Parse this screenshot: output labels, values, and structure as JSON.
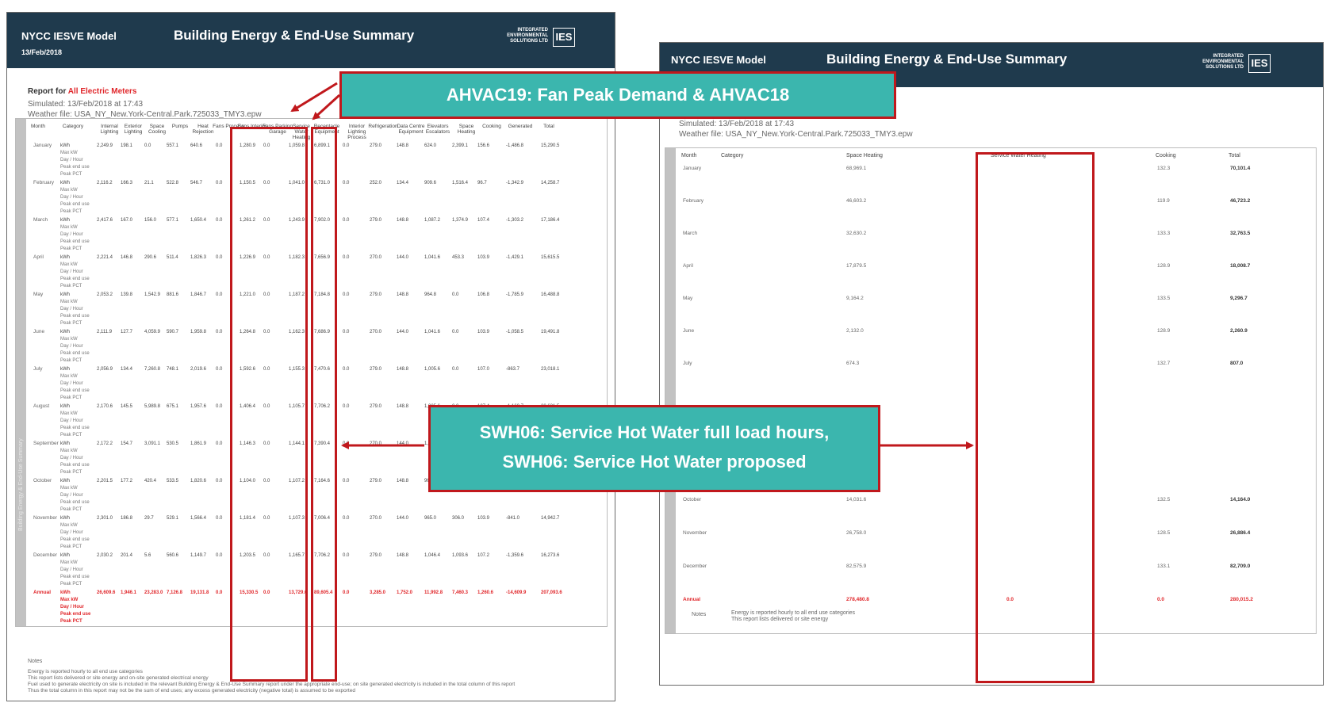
{
  "left": {
    "model_title": "NYCC IESVE Model",
    "building_title": "Building Energy & End-Use Summary",
    "date": "13/Feb/2018",
    "ies_text_1": "INTEGRATED",
    "ies_text_2": "ENVIRONMENTAL",
    "ies_text_3": "SOLUTIONS LTD",
    "ies_logo": "IES",
    "report_prefix": "Report for",
    "report_meters": "All Electric Meters",
    "simulated": "Simulated: 13/Feb/2018 at 17:43",
    "weather": "Weather file: USA_NY_New.York-Central.Park.725033_TMY3.epw",
    "sidebar_text": "Building Energy & End-Use Summary",
    "columns": [
      "Month",
      "Category",
      "Internal Lighting",
      "Exterior Lighting",
      "Space Cooling",
      "Pumps",
      "Heat Rejection",
      "Fans Process",
      "Fans Interior",
      "Fans Parking Garage",
      "Service Water Heating",
      "Receptacle Equipment",
      "Interior Lighting Process",
      "Refrigeration",
      "Data Centre Equipment",
      "Elevators Escalators",
      "Space Heating",
      "Cooking",
      "Generated",
      "Total"
    ],
    "months": [
      "January",
      "February",
      "March",
      "April",
      "May",
      "June",
      "July",
      "August",
      "September",
      "October",
      "November",
      "December",
      "Annual"
    ],
    "categories": [
      "kWh",
      "Max kW",
      "Day / Hour",
      "Peak end use",
      "Peak PCT"
    ],
    "month_rows": [
      [
        "2,249.9",
        "198.1",
        "0.0",
        "557.1",
        "640.6",
        "0.0",
        "1,280.9",
        "0.0",
        "1,059.8",
        "6,899.1",
        "0.0",
        "279.0",
        "148.8",
        "624.0",
        "2,399.1",
        "156.6",
        "-1,486.8",
        "15,290.5"
      ],
      [
        "2,116.2",
        "166.3",
        "21.1",
        "522.8",
        "546.7",
        "0.0",
        "1,150.5",
        "0.0",
        "1,041.0",
        "6,731.0",
        "0.0",
        "252.0",
        "134.4",
        "909.6",
        "1,516.4",
        "96.7",
        "-1,342.9",
        "14,258.7"
      ],
      [
        "2,417.6",
        "167.0",
        "156.0",
        "577.1",
        "1,650.4",
        "0.0",
        "1,261.2",
        "0.0",
        "1,243.9",
        "7,902.0",
        "0.0",
        "279.0",
        "148.8",
        "1,087.2",
        "1,374.9",
        "107.4",
        "-1,303.2",
        "17,186.4"
      ],
      [
        "2,221.4",
        "146.8",
        "290.6",
        "511.4",
        "1,826.3",
        "0.0",
        "1,226.9",
        "0.0",
        "1,182.3",
        "7,656.9",
        "0.0",
        "270.0",
        "144.0",
        "1,041.6",
        "453.3",
        "103.9",
        "-1,429.1",
        "15,615.5"
      ],
      [
        "2,053.2",
        "139.8",
        "1,542.9",
        "881.6",
        "1,846.7",
        "0.0",
        "1,221.0",
        "0.0",
        "1,187.2",
        "7,184.8",
        "0.0",
        "279.0",
        "148.8",
        "964.8",
        "0.0",
        "106.8",
        "-1,785.9",
        "16,488.8"
      ],
      [
        "2,111.9",
        "127.7",
        "4,059.9",
        "590.7",
        "1,959.8",
        "0.0",
        "1,264.8",
        "0.0",
        "1,162.3",
        "7,686.9",
        "0.0",
        "270.0",
        "144.0",
        "1,041.6",
        "0.0",
        "103.9",
        "-1,058.5",
        "19,491.8"
      ],
      [
        "2,056.9",
        "134.4",
        "7,260.8",
        "748.1",
        "2,019.6",
        "0.0",
        "1,592.6",
        "0.0",
        "1,155.3",
        "7,470.6",
        "0.0",
        "279.0",
        "148.8",
        "1,005.6",
        "0.0",
        "107.0",
        "-863.7",
        "23,018.1"
      ],
      [
        "2,170.6",
        "145.5",
        "5,989.8",
        "675.1",
        "1,957.6",
        "0.0",
        "1,406.4",
        "0.0",
        "1,105.7",
        "7,706.2",
        "0.0",
        "279.0",
        "148.8",
        "1,005.6",
        "0.0",
        "107.4",
        "-1,160.7",
        "20,631.5"
      ],
      [
        "2,172.2",
        "154.7",
        "3,091.1",
        "530.5",
        "1,861.9",
        "0.0",
        "1,146.3",
        "0.0",
        "1,144.1",
        "7,390.4",
        "0.0",
        "270.0",
        "144.0",
        "1,005.6",
        "0.0",
        "103.9",
        "-1,332.6",
        "17,862.5"
      ],
      [
        "2,201.5",
        "177.2",
        "420.4",
        "533.5",
        "1,820.6",
        "0.0",
        "1,104.0",
        "0.0",
        "1,107.2",
        "7,164.6",
        "0.0",
        "279.0",
        "148.8",
        "964.8",
        "36.2",
        "106.8",
        "-1,443.3",
        "14,708.0"
      ],
      [
        "2,301.0",
        "186.8",
        "29.7",
        "529.1",
        "1,566.4",
        "0.0",
        "1,181.4",
        "0.0",
        "1,107.3",
        "7,006.4",
        "0.0",
        "270.0",
        "144.0",
        "965.0",
        "306.0",
        "103.9",
        "-841.0",
        "14,942.7"
      ],
      [
        "2,030.2",
        "201.4",
        "5.6",
        "560.6",
        "1,149.7",
        "0.0",
        "1,203.5",
        "0.0",
        "1,165.7",
        "7,706.2",
        "0.0",
        "279.0",
        "148.8",
        "1,046.4",
        "1,093.6",
        "107.2",
        "-1,359.6",
        "16,273.6"
      ]
    ],
    "annual_row": [
      "26,609.6",
      "1,946.1",
      "23,283.0",
      "7,126.8",
      "19,131.8",
      "0.0",
      "15,330.5",
      "0.0",
      "13,729.6",
      "89,605.4",
      "0.0",
      "3,285.0",
      "1,752.0",
      "11,992.8",
      "7,460.3",
      "1,260.6",
      "-14,609.9",
      "207,093.6"
    ],
    "notes_label": "Notes",
    "notes": [
      "Energy is reported hourly to all end use categories",
      "This report lists delivered or site energy and on-site generated electrical energy",
      "Fuel used to generate electricity on site is included in the relevant Building Energy & End-Use Summary report under the appropriate end-use; on site generated electricity is included in the total column of this report",
      "Thus the total column in this report may not be the sum of end uses; any excess generated electricity (negative total) is assumed to be exported"
    ]
  },
  "right": {
    "model_title": "NYCC IESVE Model",
    "building_title": "Building Energy & End-Use Summary",
    "ies_text_1": "INTEGRATED",
    "ies_text_2": "ENVIRONMENTAL",
    "ies_text_3": "SOLUTIONS LTD",
    "ies_logo": "IES",
    "simulated": "Simulated: 13/Feb/2018 at 17:43",
    "weather": "Weather file: USA_NY_New.York-Central.Park.725033_TMY3.epw",
    "columns": [
      "Month",
      "Category",
      "Space Heating",
      "Service Water Heating",
      "Cooking",
      "Total"
    ],
    "months": [
      {
        "name": "January",
        "heat": "68,969.1",
        "cook": "132.3",
        "total": "70,101.4"
      },
      {
        "name": "February",
        "heat": "46,603.2",
        "cook": "119.9",
        "total": "46,723.2"
      },
      {
        "name": "March",
        "heat": "32,630.2",
        "cook": "133.3",
        "total": "32,763.5"
      },
      {
        "name": "April",
        "heat": "17,879.5",
        "cook": "128.9",
        "total": "18,008.7"
      },
      {
        "name": "May",
        "heat": "9,164.2",
        "cook": "133.5",
        "total": "9,296.7"
      },
      {
        "name": "June",
        "heat": "2,132.0",
        "cook": "128.9",
        "total": "2,260.9"
      },
      {
        "name": "July",
        "heat": "674.3",
        "cook": "132.7",
        "total": "807.0"
      },
      {
        "name": "October",
        "heat": "14,031.6",
        "cook": "132.5",
        "total": "14,164.0"
      },
      {
        "name": "November",
        "heat": "26,758.0",
        "cook": "128.5",
        "total": "26,886.4"
      },
      {
        "name": "December",
        "heat": "82,575.9",
        "cook": "133.1",
        "total": "82,709.0"
      }
    ],
    "annual": {
      "name": "Annual",
      "heat": "278,480.8",
      "swh": "0.0",
      "cook": "0.0",
      "total": "280,015.2"
    },
    "notes_label": "Notes",
    "notes": [
      "Energy is reported hourly to all end use categories",
      "This report lists delivered or site energy"
    ]
  },
  "callouts": {
    "top": "AHVAC19: Fan Peak Demand & AHVAC18",
    "bottom_line1": "SWH06: Service Hot Water full load hours,",
    "bottom_line2": "SWH06: Service Hot Water proposed"
  },
  "colors": {
    "header": "#1f3a4d",
    "highlight": "#c0181c",
    "callout": "#3bb6ae",
    "annual": "#e0262a"
  }
}
